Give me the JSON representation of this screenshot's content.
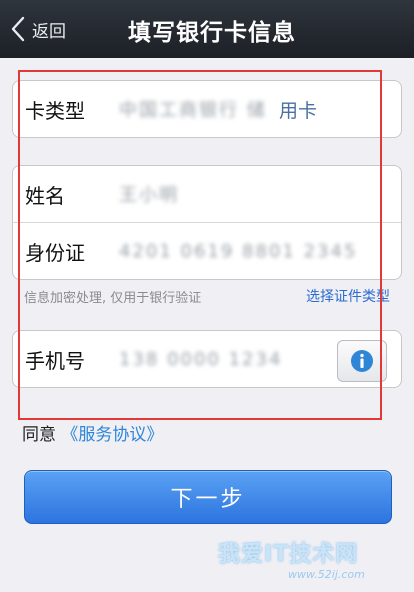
{
  "nav": {
    "back_label": "返回",
    "title": "填写银行卡信息"
  },
  "card_group": {
    "type_label": "卡类型",
    "type_value_masked": "中国工商银行 储",
    "type_value_suffix": "用卡"
  },
  "identity_group": {
    "name_label": "姓名",
    "name_value_masked": "王小明",
    "id_label": "身份证",
    "id_value_masked": "4201 0619 8801 2345"
  },
  "hint_text": "信息加密处理, 仅用于银行验证",
  "select_id_type_link": "选择证件类型",
  "phone_group": {
    "label": "手机号",
    "value_masked": "138 0000 1234"
  },
  "agree": {
    "prefix": "同意",
    "link": "《服务协议》"
  },
  "next_button_label": "下一步",
  "watermark": {
    "main": "我爱IT技术网",
    "sub": "www.52ij.com"
  },
  "colors": {
    "navbar": "#1c2026",
    "background": "#efeff4",
    "primary_button": "#2d74e0",
    "link": "#2d86d9",
    "highlight_box": "#e23838"
  }
}
